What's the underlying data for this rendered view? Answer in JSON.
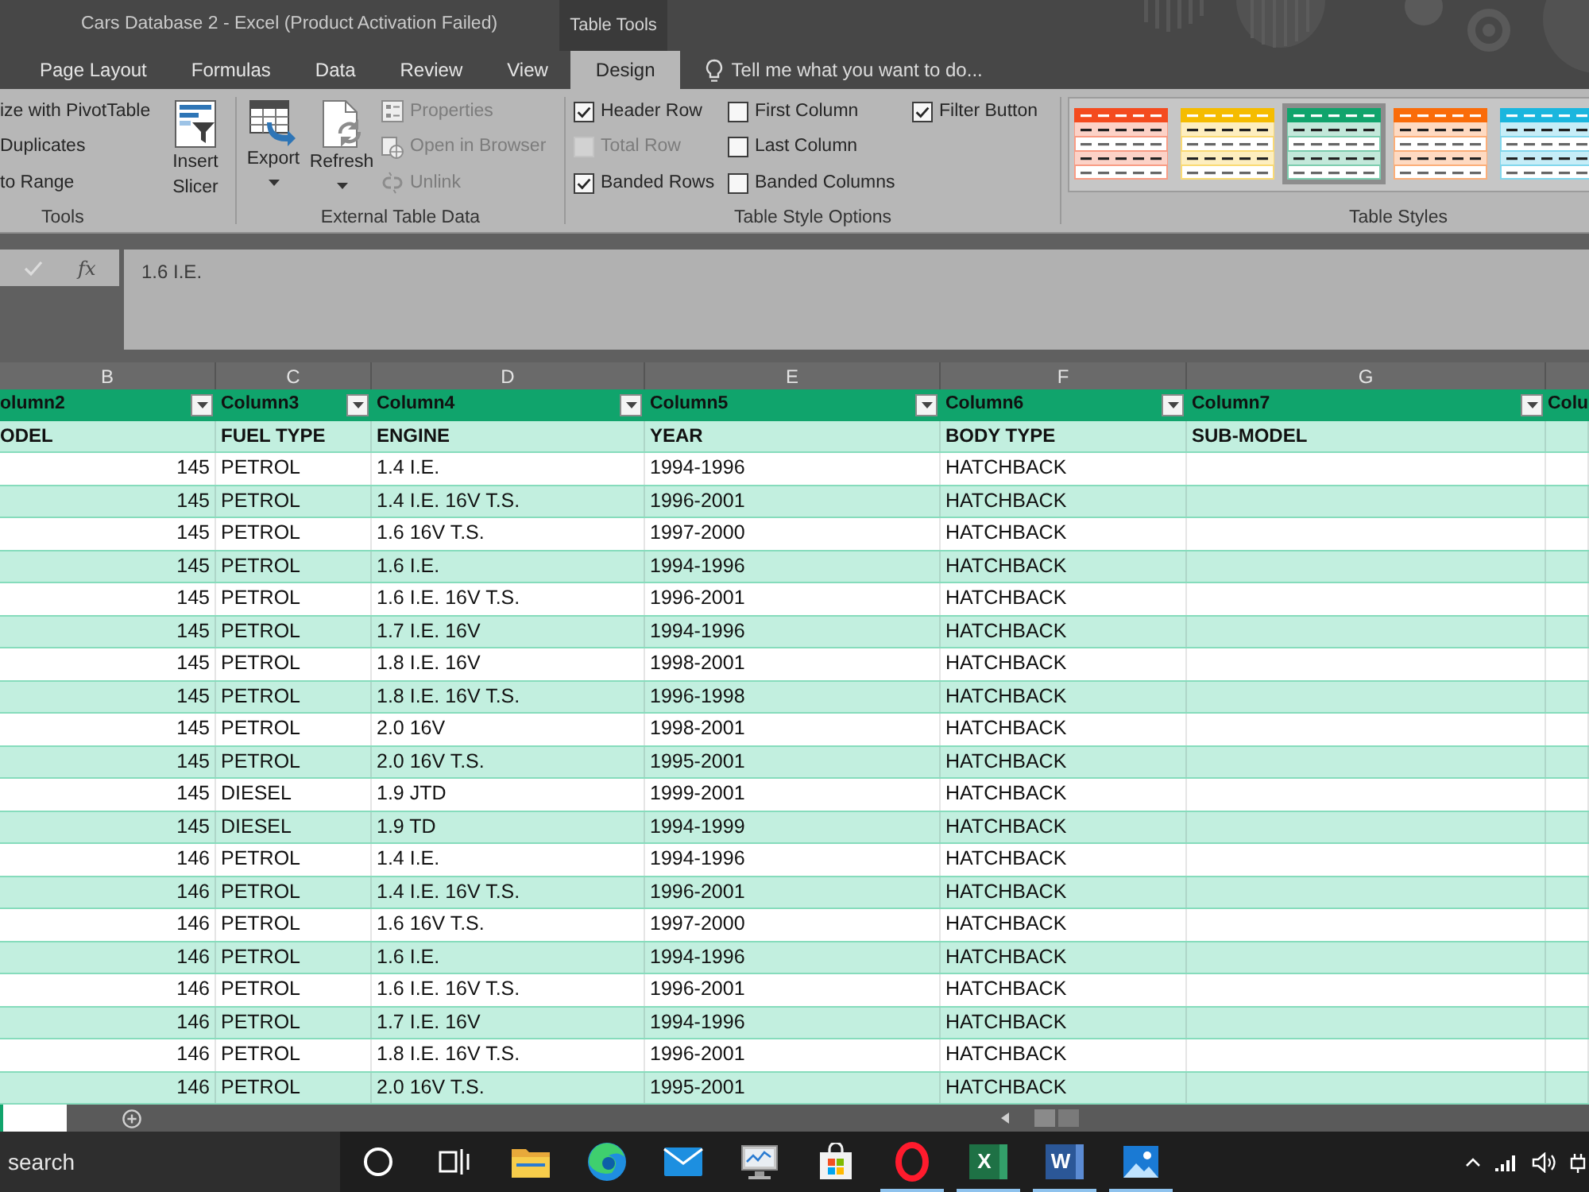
{
  "window": {
    "title": "Cars Database 2 - Excel (Product Activation Failed)",
    "context_tab": "Table Tools"
  },
  "ribbon_tabs": [
    {
      "label": "Page Layout",
      "selected": false
    },
    {
      "label": "Formulas",
      "selected": false
    },
    {
      "label": "Data",
      "selected": false
    },
    {
      "label": "Review",
      "selected": false
    },
    {
      "label": "View",
      "selected": false
    },
    {
      "label": "Design",
      "selected": true
    }
  ],
  "tell_me": {
    "placeholder": "Tell me what you want to do..."
  },
  "ribbon": {
    "tools": {
      "label": "Tools",
      "commands": [
        {
          "label": "ize with PivotTable",
          "disabled": false
        },
        {
          "label": "Duplicates",
          "disabled": false
        },
        {
          "label": "to Range",
          "disabled": false
        }
      ],
      "large_buttons": [
        {
          "label": "Insert Slicer",
          "dropdown": false,
          "disabled": false
        }
      ]
    },
    "external_data": {
      "label": "External Table Data",
      "large_buttons": [
        {
          "label": "Export",
          "dropdown": true,
          "disabled": false
        },
        {
          "label": "Refresh",
          "dropdown": true,
          "disabled": false
        }
      ],
      "commands": [
        {
          "label": "Properties",
          "disabled": true
        },
        {
          "label": "Open in Browser",
          "disabled": true
        },
        {
          "label": "Unlink",
          "disabled": true
        }
      ]
    },
    "style_options": {
      "label": "Table Style Options",
      "checks": [
        {
          "label": "Header Row",
          "checked": true,
          "disabled": false
        },
        {
          "label": "Total Row",
          "checked": false,
          "disabled": true
        },
        {
          "label": "Banded Rows",
          "checked": true,
          "disabled": false
        },
        {
          "label": "First Column",
          "checked": false,
          "disabled": false
        },
        {
          "label": "Last Column",
          "checked": false,
          "disabled": false
        },
        {
          "label": "Banded Columns",
          "checked": false,
          "disabled": false
        },
        {
          "label": "Filter Button",
          "checked": true,
          "disabled": false
        }
      ]
    },
    "table_styles": {
      "label": "Table Styles",
      "items": [
        {
          "color": "#f44b1f",
          "selected": false
        },
        {
          "color": "#f5bc00",
          "selected": false
        },
        {
          "color": "#10a46c",
          "selected": true
        },
        {
          "color": "#fa6c0a",
          "selected": false
        },
        {
          "color": "#1ab6de",
          "selected": false
        }
      ]
    }
  },
  "formula_bar": {
    "function_label": "fx",
    "value": "1.6 I.E."
  },
  "sheet": {
    "column_letters": [
      "B",
      "C",
      "D",
      "E",
      "F",
      "G"
    ],
    "table": {
      "headers": [
        {
          "label": "olumn2",
          "filter": true
        },
        {
          "label": "Column3",
          "filter": true
        },
        {
          "label": "Column4",
          "filter": true
        },
        {
          "label": "Column5",
          "filter": true
        },
        {
          "label": "Column6",
          "filter": true
        },
        {
          "label": "Column7",
          "filter": true
        },
        {
          "label": "Colu",
          "filter": false
        }
      ],
      "label_row": [
        "ODEL",
        "FUEL TYPE",
        "ENGINE",
        "YEAR",
        "BODY TYPE",
        "SUB-MODEL"
      ],
      "rows": [
        {
          "cells": [
            "145",
            "PETROL",
            "1.4 I.E.",
            "1994-1996",
            "HATCHBACK"
          ]
        },
        {
          "cells": [
            "145",
            "PETROL",
            "1.4 I.E. 16V T.S.",
            "1996-2001",
            "HATCHBACK"
          ]
        },
        {
          "cells": [
            "145",
            "PETROL",
            "1.6 16V T.S.",
            "1997-2000",
            "HATCHBACK"
          ]
        },
        {
          "cells": [
            "145",
            "PETROL",
            "1.6 I.E.",
            "1994-1996",
            "HATCHBACK"
          ]
        },
        {
          "cells": [
            "145",
            "PETROL",
            "1.6 I.E. 16V T.S.",
            "1996-2001",
            "HATCHBACK"
          ]
        },
        {
          "cells": [
            "145",
            "PETROL",
            "1.7 I.E. 16V",
            "1994-1996",
            "HATCHBACK"
          ]
        },
        {
          "cells": [
            "145",
            "PETROL",
            "1.8 I.E. 16V",
            "1998-2001",
            "HATCHBACK"
          ]
        },
        {
          "cells": [
            "145",
            "PETROL",
            "1.8 I.E. 16V T.S.",
            "1996-1998",
            "HATCHBACK"
          ]
        },
        {
          "cells": [
            "145",
            "PETROL",
            "2.0 16V",
            "1998-2001",
            "HATCHBACK"
          ]
        },
        {
          "cells": [
            "145",
            "PETROL",
            "2.0 16V T.S.",
            "1995-2001",
            "HATCHBACK"
          ]
        },
        {
          "cells": [
            "145",
            "DIESEL",
            "1.9 JTD",
            "1999-2001",
            "HATCHBACK"
          ]
        },
        {
          "cells": [
            "145",
            "DIESEL",
            "1.9 TD",
            "1994-1999",
            "HATCHBACK"
          ]
        },
        {
          "cells": [
            "146",
            "PETROL",
            "1.4 I.E.",
            "1994-1996",
            "HATCHBACK"
          ]
        },
        {
          "cells": [
            "146",
            "PETROL",
            "1.4 I.E. 16V T.S.",
            "1996-2001",
            "HATCHBACK"
          ]
        },
        {
          "cells": [
            "146",
            "PETROL",
            "1.6 16V T.S.",
            "1997-2000",
            "HATCHBACK"
          ]
        },
        {
          "cells": [
            "146",
            "PETROL",
            "1.6 I.E.",
            "1994-1996",
            "HATCHBACK"
          ]
        },
        {
          "cells": [
            "146",
            "PETROL",
            "1.6 I.E. 16V T.S.",
            "1996-2001",
            "HATCHBACK"
          ]
        },
        {
          "cells": [
            "146",
            "PETROL",
            "1.7 I.E. 16V",
            "1994-1996",
            "HATCHBACK"
          ]
        },
        {
          "cells": [
            "146",
            "PETROL",
            "1.8 I.E. 16V T.S.",
            "1996-2001",
            "HATCHBACK"
          ]
        },
        {
          "cells": [
            "146",
            "PETROL",
            "2.0 16V T.S.",
            "1995-2001",
            "HATCHBACK"
          ]
        }
      ]
    }
  },
  "taskbar": {
    "search": {
      "placeholder": "search"
    },
    "apps": [
      {
        "kind": "circle",
        "running": false
      },
      {
        "kind": "taskview",
        "running": false
      },
      {
        "kind": "folder",
        "running": false
      },
      {
        "kind": "browser",
        "running": false
      },
      {
        "kind": "mail",
        "running": false
      },
      {
        "kind": "monitor",
        "running": false
      },
      {
        "kind": "store",
        "running": false
      },
      {
        "kind": "ring",
        "running": true
      },
      {
        "kind": "sheet",
        "letter": "X",
        "running": true
      },
      {
        "kind": "document",
        "letter": "W",
        "running": true
      },
      {
        "kind": "picture",
        "running": true
      }
    ]
  }
}
